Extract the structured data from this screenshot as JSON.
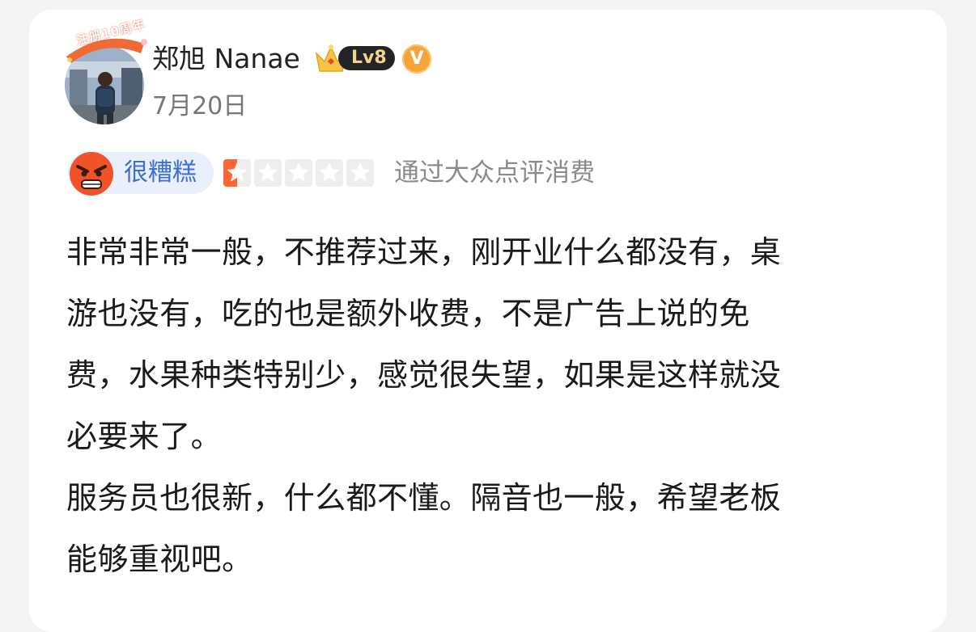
{
  "review": {
    "user": {
      "name": "郑旭 Nanae",
      "anniversary_badge": "注册10周年",
      "level": "Lv8",
      "vip_mark": "V",
      "avatar_icon": "user-avatar-photo"
    },
    "date": "7月20日",
    "rating": {
      "mood_label": "很糟糕",
      "mood_icon": "angry-face-icon",
      "stars": 0.5,
      "max_stars": 5,
      "star_color": "#ff6633",
      "consume_note": "通过大众点评消费"
    },
    "paragraphs": [
      "非常非常一般，不推荐过来，刚开业什么都没有，桌\n游也没有，吃的也是额外收费，不是广告上说的免\n费，水果种类特别少，感觉很失望，如果是这样就没\n必要来了。",
      "服务员也很新，什么都不懂。隔音也一般，希望老板\n能够重视吧。"
    ]
  },
  "colors": {
    "mood_pill_bg": "#e9f0fb",
    "mood_text": "#3f6fd1",
    "level_pill": "#222428",
    "vip_badge": "#f5a43b",
    "secondary_text": "#8a8a8a"
  }
}
